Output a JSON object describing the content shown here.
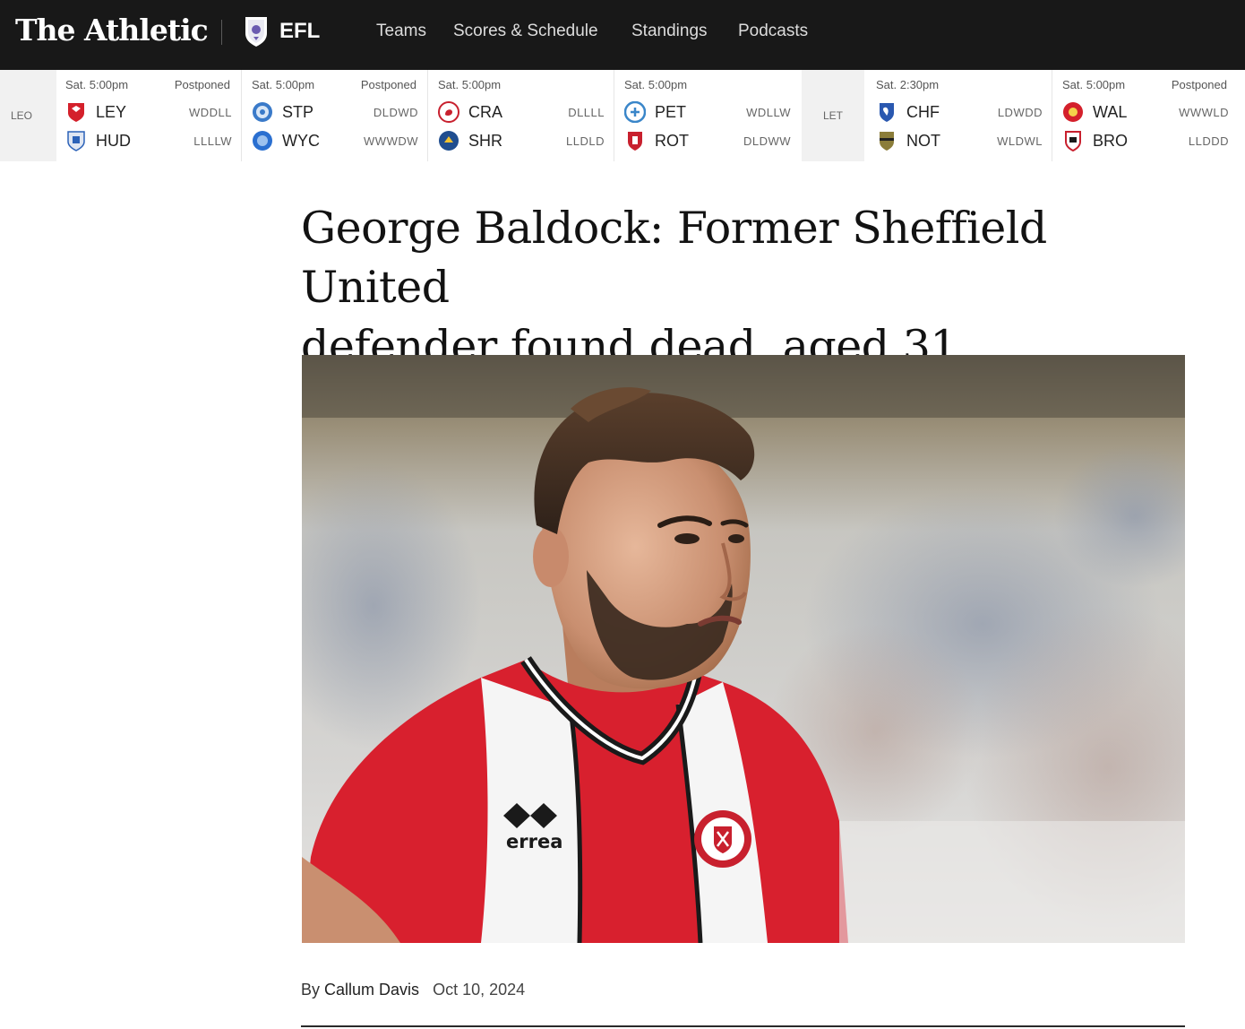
{
  "brand": {
    "name": "The Athletic",
    "section": "EFL"
  },
  "nav": {
    "items": [
      "Teams",
      "Scores & Schedule",
      "Standings",
      "Podcasts"
    ]
  },
  "scores": {
    "leagues": [
      "LEO",
      "LET"
    ],
    "games": [
      {
        "time": "Sat. 5:00pm",
        "status": "Postponed",
        "home": {
          "abbr": "LEY",
          "form": "WDDLL",
          "crest_color": "#d4202b",
          "crest_icon": "leyton-orient-crest"
        },
        "away": {
          "abbr": "HUD",
          "form": "LLLLW",
          "crest_color": "#2c62b8",
          "crest_icon": "huddersfield-crest"
        }
      },
      {
        "time": "Sat. 5:00pm",
        "status": "Postponed",
        "home": {
          "abbr": "STP",
          "form": "DLDWD",
          "crest_color": "#3a7ac9",
          "crest_icon": "stockport-crest"
        },
        "away": {
          "abbr": "WYC",
          "form": "WWWDW",
          "crest_color": "#2a6fd0",
          "crest_icon": "wycombe-crest"
        }
      },
      {
        "time": "Sat. 5:00pm",
        "status": "",
        "home": {
          "abbr": "CRA",
          "form": "DLLLL",
          "crest_color": "#c8202e",
          "crest_icon": "crawley-crest"
        },
        "away": {
          "abbr": "SHR",
          "form": "LLDLD",
          "crest_color": "#1f4d8f",
          "crest_icon": "shrewsbury-crest"
        }
      },
      {
        "time": "Sat. 5:00pm",
        "status": "",
        "home": {
          "abbr": "PET",
          "form": "WDLLW",
          "crest_color": "#3a86c9",
          "crest_icon": "peterborough-crest"
        },
        "away": {
          "abbr": "ROT",
          "form": "DLDWW",
          "crest_color": "#c8202e",
          "crest_icon": "rotherham-crest"
        }
      },
      {
        "time": "Sat. 2:30pm",
        "status": "",
        "home": {
          "abbr": "CHF",
          "form": "LDWDD",
          "crest_color": "#2a58b0",
          "crest_icon": "chesterfield-crest"
        },
        "away": {
          "abbr": "NOT",
          "form": "WLDWL",
          "crest_color": "#8b7d3a",
          "crest_icon": "notts-county-crest"
        }
      },
      {
        "time": "Sat. 5:00pm",
        "status": "Postponed",
        "home": {
          "abbr": "WAL",
          "form": "WWWLD",
          "crest_color": "#d4202b",
          "crest_icon": "walsall-crest"
        },
        "away": {
          "abbr": "BRO",
          "form": "LLDDD",
          "crest_color": "#c8202e",
          "crest_icon": "bromley-crest"
        }
      }
    ]
  },
  "article": {
    "headline_line1": "George Baldock: Former Sheffield United",
    "headline_line2": "defender found dead, aged 31",
    "kit_brand": "errea",
    "byline_prefix": "By",
    "author": "Callum Davis",
    "date": "Oct 10, 2024"
  },
  "colors": {
    "nav_bg": "#181818",
    "league_bg": "#f1f1f1",
    "kit_red": "#d8202e",
    "text": "#121212"
  }
}
